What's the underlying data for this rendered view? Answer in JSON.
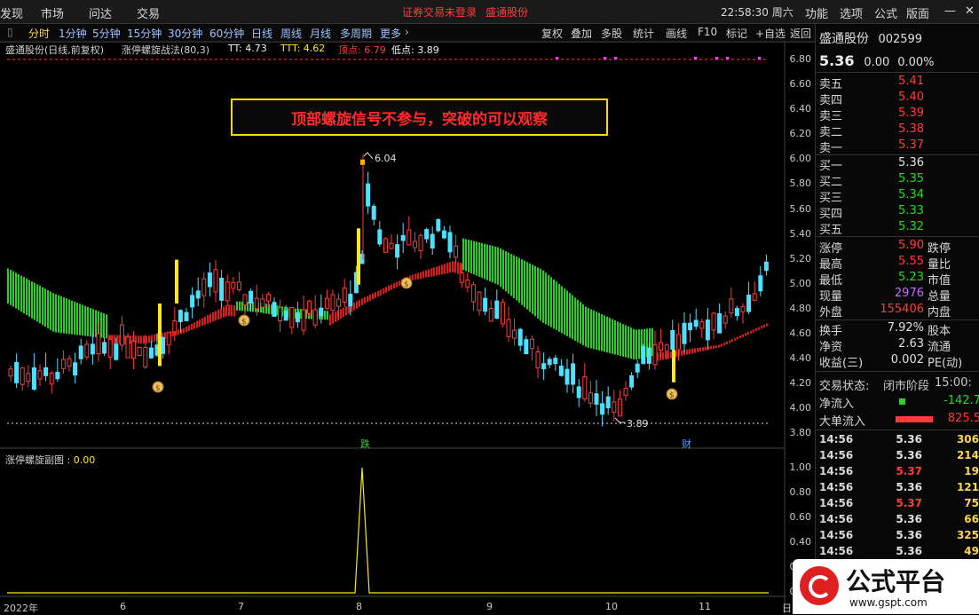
{
  "topbar": {
    "items": [
      "发现",
      "市场",
      "问达",
      "交易"
    ],
    "notice": "证券交易未登录",
    "stock": "盛通股份",
    "time": "22:58:30 周六",
    "right": [
      "功能",
      "选项",
      "公式",
      "版面"
    ]
  },
  "tabs": {
    "items": [
      "分时",
      "1分钟",
      "5分钟",
      "15分钟",
      "30分钟",
      "60分钟",
      "日线",
      "周线",
      "月线",
      "多周期",
      "更多"
    ],
    "active": "分时",
    "tools": [
      "复权",
      "叠加",
      "多股",
      "统计",
      "画线",
      "F10",
      "标记",
      "+自选",
      "返回"
    ]
  },
  "info": {
    "title": "盛通股份(日线,前复权)",
    "formula": "涨停螺旋战法(80,3)",
    "tt": "TT: 4.73",
    "ttt": "TTT: 4.62",
    "top": "顶点: 6.79",
    "low": "低点: 3.89"
  },
  "banner": "顶部螺旋信号不参与，突破的可以观察",
  "main_y": [
    "6.80",
    "6.60",
    "6.40",
    "6.20",
    "6.00",
    "5.80",
    "5.60",
    "5.40",
    "5.20",
    "5.00",
    "4.80",
    "4.60",
    "4.40",
    "4.20",
    "4.00",
    "3.80"
  ],
  "labels": {
    "high": "6.04",
    "low": "3.89",
    "die": "跌",
    "cai": "财"
  },
  "sub": {
    "title": "涨停螺旋副图",
    "value": "0.00",
    "y": [
      "1.00",
      "0.80",
      "0.60",
      "0.40",
      "0.20",
      "0.00"
    ]
  },
  "x_axis": [
    "2022年",
    "6",
    "7",
    "8",
    "9",
    "10",
    "11",
    "日"
  ],
  "quote": {
    "name": "盛通股份",
    "code": "002599",
    "price": "5.36",
    "change": "0.00",
    "pct": "0.00%",
    "asks": [
      {
        "l": "卖五",
        "p": "5.41"
      },
      {
        "l": "卖四",
        "p": "5.40"
      },
      {
        "l": "卖三",
        "p": "5.39"
      },
      {
        "l": "卖二",
        "p": "5.38"
      },
      {
        "l": "卖一",
        "p": "5.37"
      }
    ],
    "bids": [
      {
        "l": "买一",
        "p": "5.36"
      },
      {
        "l": "买二",
        "p": "5.35"
      },
      {
        "l": "买三",
        "p": "5.34"
      },
      {
        "l": "买四",
        "p": "5.33"
      },
      {
        "l": "买五",
        "p": "5.32"
      }
    ],
    "stats": [
      {
        "a": "涨停",
        "b": "5.90",
        "c": "跌停"
      },
      {
        "a": "最高",
        "b": "5.55",
        "c": "量比"
      },
      {
        "a": "最低",
        "b": "5.23",
        "c": "市值"
      },
      {
        "a": "现量",
        "b": "2976",
        "c": "总量"
      },
      {
        "a": "外盘",
        "b": "155406",
        "c": "内盘"
      },
      {
        "a": "换手",
        "b": "7.92%",
        "c": "股本"
      },
      {
        "a": "净资",
        "b": "2.63",
        "c": "流通"
      },
      {
        "a": "收益(三)",
        "b": "0.002",
        "c": "PE(动)"
      }
    ],
    "status_label": "交易状态:",
    "status": "闭市阶段",
    "status_time": "15:00:",
    "netflow_label": "净流入",
    "netflow": "-142.7",
    "bigflow_label": "大单流入",
    "bigflow": "825.5",
    "ticks": [
      {
        "t": "14:56",
        "p": "5.36",
        "v": "306"
      },
      {
        "t": "14:56",
        "p": "5.36",
        "v": "214"
      },
      {
        "t": "14:56",
        "p": "5.37",
        "v": "19"
      },
      {
        "t": "14:56",
        "p": "5.36",
        "v": "121"
      },
      {
        "t": "14:56",
        "p": "5.37",
        "v": "75"
      },
      {
        "t": "14:56",
        "p": "5.36",
        "v": "66"
      },
      {
        "t": "14:56",
        "p": "5.36",
        "v": "325"
      },
      {
        "t": "14:56",
        "p": "5.36",
        "v": "49"
      }
    ]
  },
  "logo": {
    "text": "公式平台",
    "url": "www.gspt.com"
  },
  "colors": {
    "up": "#ff3b3b",
    "down": "#4ee0ff",
    "ribbon_green": "#22d322",
    "ribbon_red": "#e01818",
    "signal": "#ffe81a"
  }
}
